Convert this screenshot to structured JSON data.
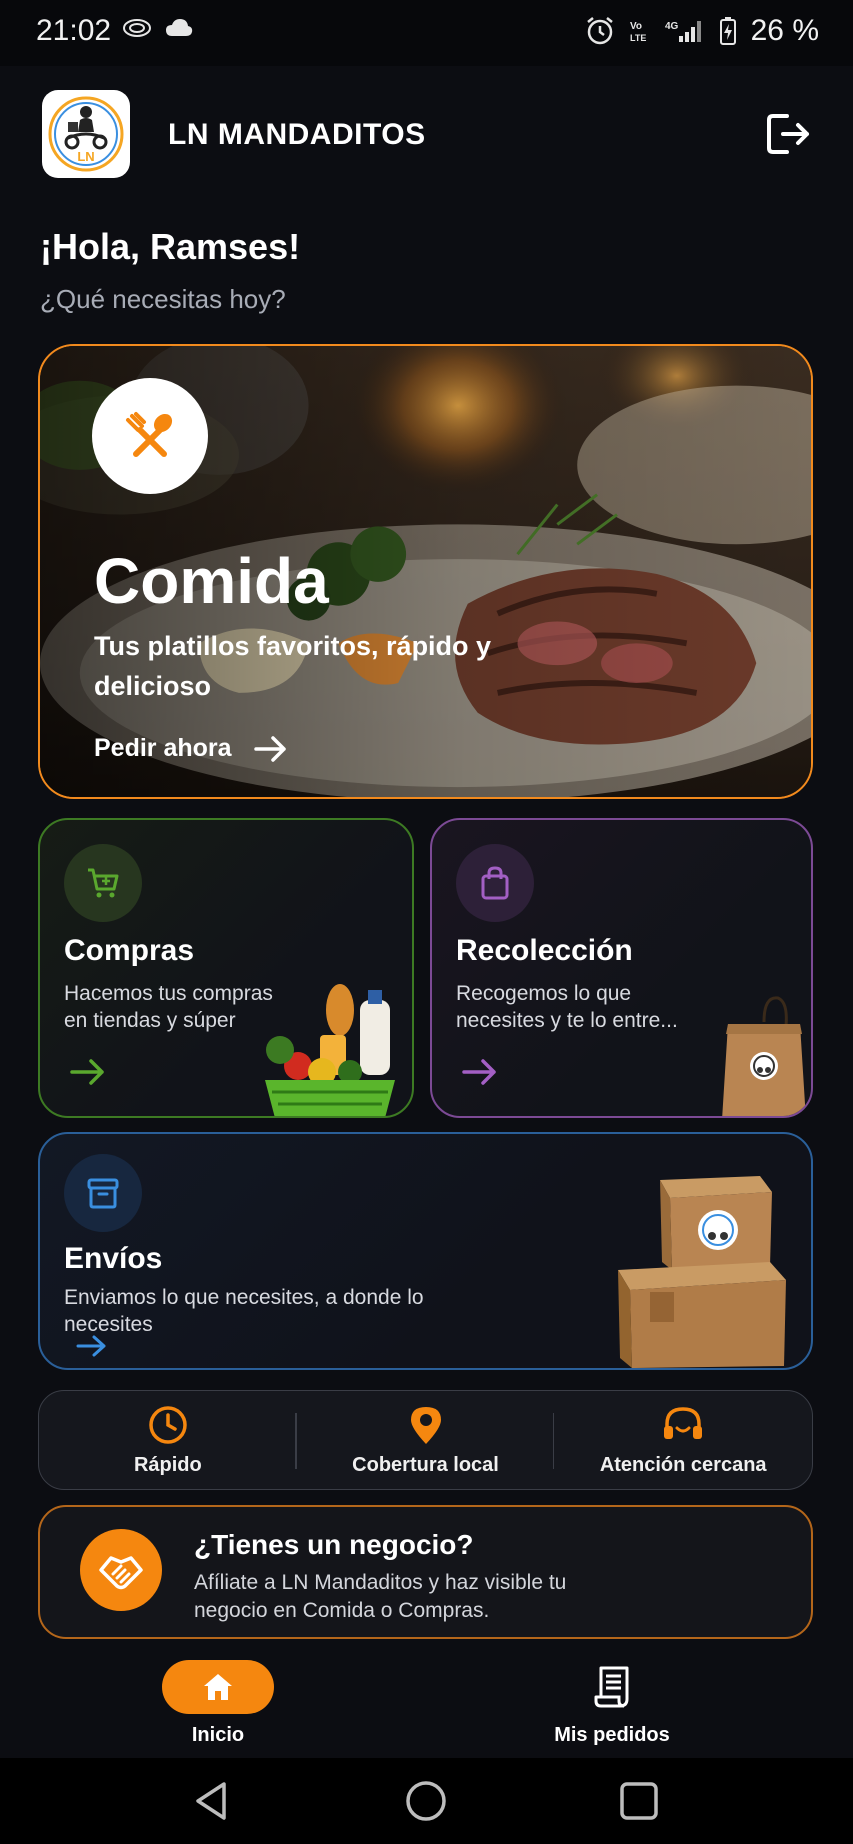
{
  "status_bar": {
    "time": "21:02",
    "battery": "26 %"
  },
  "header": {
    "app_title": "LN MANDADITOS",
    "logo_text": "LN"
  },
  "greeting": {
    "title": "¡Hola, Ramses!",
    "subtitle": "¿Qué necesitas hoy?"
  },
  "hero": {
    "title": "Comida",
    "subtitle": "Tus platillos favoritos, rápido y delicioso",
    "cta": "Pedir ahora",
    "accent": "#f28a1d"
  },
  "services": {
    "compras": {
      "title": "Compras",
      "description": "Hacemos tus compras en tiendas y súper",
      "accent": "#5aa82e"
    },
    "recoleccion": {
      "title": "Recolección",
      "description": "Recogemos lo que necesites y te lo entre...",
      "accent": "#a35fc4"
    },
    "envios": {
      "title": "Envíos",
      "description": "Enviamos lo que necesites, a donde lo necesites",
      "accent": "#3a8fe0"
    }
  },
  "features": [
    {
      "label": "Rápido",
      "icon": "clock-icon"
    },
    {
      "label": "Cobertura local",
      "icon": "location-pin-icon"
    },
    {
      "label": "Atención cercana",
      "icon": "headset-icon"
    }
  ],
  "business": {
    "title": "¿Tienes un negocio?",
    "description": "Afíliate a LN Mandaditos y haz visible tu negocio en Comida o Compras."
  },
  "bottom_nav": [
    {
      "label": "Inicio",
      "icon": "home-icon",
      "active": true
    },
    {
      "label": "Mis pedidos",
      "icon": "receipt-icon",
      "active": false
    }
  ],
  "colors": {
    "primary": "#f5870f",
    "background": "#0c0d12"
  }
}
